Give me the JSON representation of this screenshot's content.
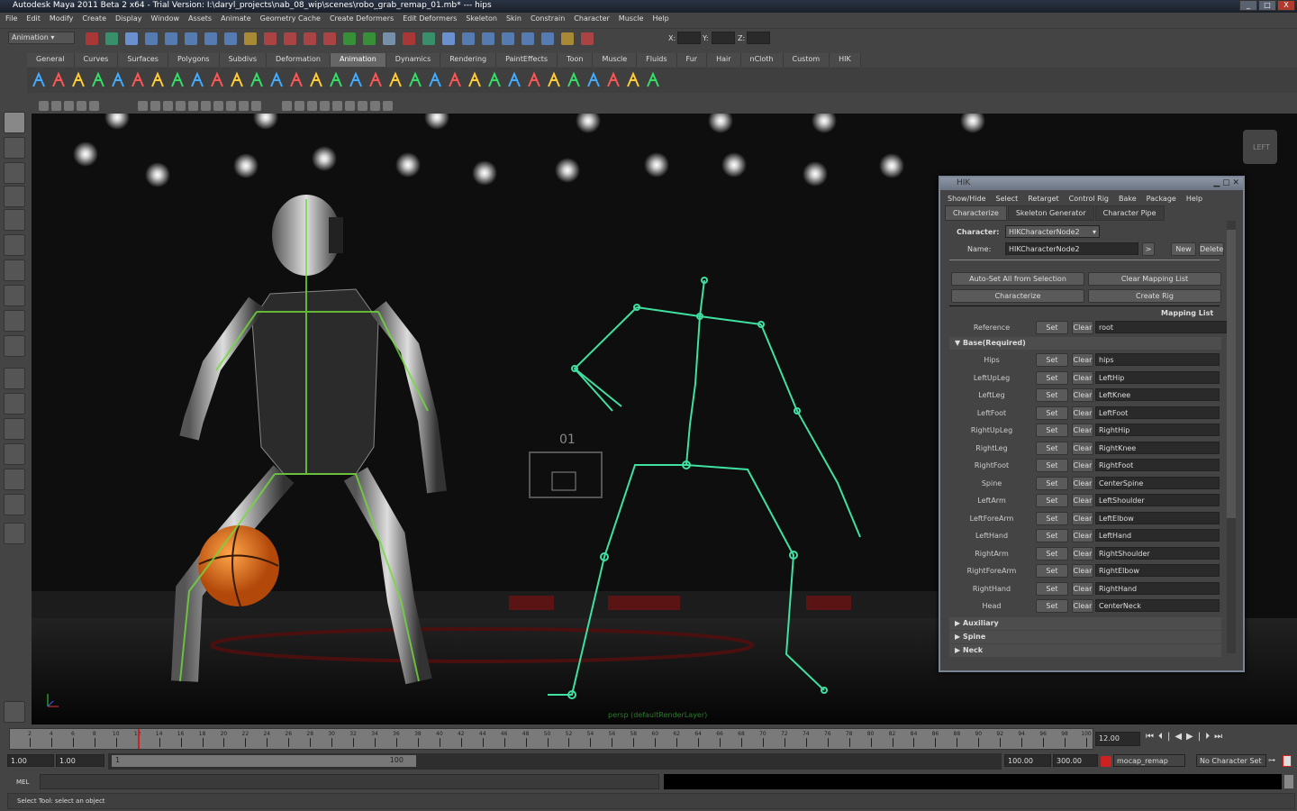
{
  "window": {
    "title": "Autodesk Maya 2011 Beta 2 x64 - Trial Version: I:\\daryl_projects\\nab_08_wip\\scenes\\robo_grab_remap_01.mb*  ---  hips",
    "min": "_",
    "max": "□",
    "close": "X"
  },
  "menubar": [
    "File",
    "Edit",
    "Modify",
    "Create",
    "Display",
    "Window",
    "Assets",
    "Animate",
    "Geometry Cache",
    "Create Deformers",
    "Edit Deformers",
    "Skeleton",
    "Skin",
    "Constrain",
    "Character",
    "Muscle",
    "Help"
  ],
  "statusline": {
    "mode": "Animation",
    "x_label": "X:",
    "y_label": "Y:",
    "z_label": "Z:"
  },
  "shelf_tabs": [
    "General",
    "Curves",
    "Surfaces",
    "Polygons",
    "Subdivs",
    "Deformation",
    "Animation",
    "Dynamics",
    "Rendering",
    "PaintEffects",
    "Toon",
    "Muscle",
    "Fluids",
    "Fur",
    "Hair",
    "nCloth",
    "Custom",
    "HIK"
  ],
  "shelf_active": "Animation",
  "viewport": {
    "camera_label": "persp (defaultRenderLayer)",
    "viewcube": "LEFT",
    "scoreboard": "01"
  },
  "hik": {
    "title": "HIK",
    "menu": [
      "Show/Hide",
      "Select",
      "Retarget",
      "Control Rig",
      "Bake",
      "Package",
      "Help"
    ],
    "tabs": [
      "Characterize",
      "Skeleton Generator",
      "Character Pipe"
    ],
    "character_label": "Character:",
    "character_value": "HIKCharacterNode2",
    "name_label": "Name:",
    "name_value": "HIKCharacterNode2",
    "arrow": ">",
    "new": "New",
    "delete": "Delete",
    "auto_set": "Auto-Set All from Selection",
    "clear_mapping": "Clear Mapping List",
    "characterize": "Characterize",
    "create_rig": "Create Rig",
    "mapping_list": "Mapping List",
    "reference": {
      "label": "Reference",
      "set": "Set",
      "clear": "Clear",
      "value": "root"
    },
    "base_section": "Base(Required)",
    "rows": [
      {
        "label": "Hips",
        "value": "hips"
      },
      {
        "label": "LeftUpLeg",
        "value": "LeftHip"
      },
      {
        "label": "LeftLeg",
        "value": "LeftKnee"
      },
      {
        "label": "LeftFoot",
        "value": "LeftFoot"
      },
      {
        "label": "RightUpLeg",
        "value": "RightHip"
      },
      {
        "label": "RightLeg",
        "value": "RightKnee"
      },
      {
        "label": "RightFoot",
        "value": "RightFoot"
      },
      {
        "label": "Spine",
        "value": "CenterSpine"
      },
      {
        "label": "LeftArm",
        "value": "LeftShoulder"
      },
      {
        "label": "LeftForeArm",
        "value": "LeftElbow"
      },
      {
        "label": "LeftHand",
        "value": "LeftHand"
      },
      {
        "label": "RightArm",
        "value": "RightShoulder"
      },
      {
        "label": "RightForeArm",
        "value": "RightElbow"
      },
      {
        "label": "RightHand",
        "value": "RightHand"
      },
      {
        "label": "Head",
        "value": "CenterNeck"
      }
    ],
    "set": "Set",
    "clear": "Clear",
    "more_sections": [
      "Auxiliary",
      "Spine",
      "Neck"
    ]
  },
  "timeline": {
    "ticks": [
      2,
      4,
      6,
      8,
      10,
      12,
      14,
      16,
      18,
      20,
      22,
      24,
      26,
      28,
      30,
      32,
      34,
      36,
      38,
      40,
      42,
      44,
      46,
      48,
      50,
      52,
      54,
      56,
      58,
      60,
      62,
      64,
      66,
      68,
      70,
      72,
      74,
      76,
      78,
      80,
      82,
      84,
      86,
      88,
      90,
      92,
      94,
      96,
      98,
      100
    ],
    "current_frame": "12.00",
    "current": 12
  },
  "range": {
    "start": "1.00",
    "playback_start": "1.00",
    "slider_start": "1",
    "slider_end": "100",
    "playback_end": "100.00",
    "end": "300.00",
    "anim_layer": "mocap_remap",
    "character_set": "No Character Set"
  },
  "mel": {
    "label": "MEL"
  },
  "helpline": "Select Tool: select an object"
}
